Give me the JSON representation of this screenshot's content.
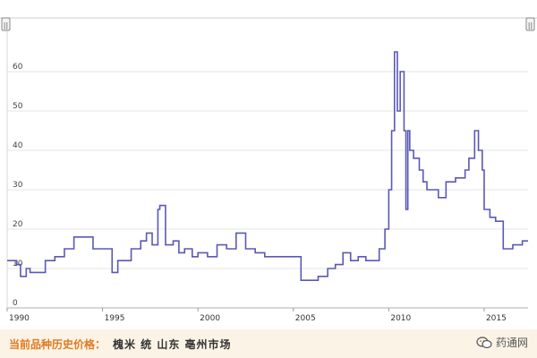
{
  "chart_data": {
    "type": "line",
    "title": "",
    "xlabel": "",
    "ylabel": "",
    "xlim": [
      1990,
      2017.3
    ],
    "ylim": [
      0,
      70
    ],
    "x_ticks": [
      "1990",
      "1995",
      "2000",
      "2005",
      "2010",
      "2015"
    ],
    "y_ticks": [
      "0",
      "10",
      "20",
      "30",
      "40",
      "50",
      "60"
    ],
    "grid": "horizontal",
    "line_color": "#5a58b8",
    "series": [
      {
        "name": "",
        "x": [
          1990.0,
          1990.5,
          1990.7,
          1991.0,
          1991.2,
          1991.5,
          1992.0,
          1992.5,
          1993.0,
          1993.5,
          1994.0,
          1994.5,
          1995.0,
          1995.2,
          1995.5,
          1995.8,
          1996.2,
          1996.5,
          1997.0,
          1997.3,
          1997.6,
          1997.9,
          1998.0,
          1998.3,
          1998.7,
          1999.0,
          1999.3,
          1999.7,
          2000.0,
          2000.5,
          2001.0,
          2001.5,
          2002.0,
          2002.5,
          2003.0,
          2003.5,
          2004.0,
          2004.5,
          2004.9,
          2005.1,
          2005.4,
          2005.8,
          2006.3,
          2006.8,
          2007.2,
          2007.6,
          2008.0,
          2008.4,
          2008.8,
          2009.2,
          2009.5,
          2009.8,
          2010.0,
          2010.15,
          2010.3,
          2010.45,
          2010.6,
          2010.8,
          2010.9,
          2011.0,
          2011.1,
          2011.3,
          2011.6,
          2011.8,
          2012.0,
          2012.3,
          2012.6,
          2013.0,
          2013.5,
          2014.0,
          2014.2,
          2014.5,
          2014.7,
          2014.9,
          2015.0,
          2015.3,
          2015.6,
          2016.0,
          2016.5,
          2017.0,
          2017.2
        ],
        "y": [
          12,
          11,
          8,
          10,
          9,
          9,
          12,
          13,
          15,
          18,
          18,
          15,
          15,
          15,
          9,
          12,
          12,
          15,
          17,
          19,
          16,
          25,
          26,
          16,
          17,
          14,
          15,
          13,
          14,
          13,
          16,
          15,
          19,
          15,
          14,
          13,
          13,
          13,
          13,
          13,
          7,
          7,
          8,
          10,
          11,
          14,
          12,
          13,
          12,
          12,
          15,
          20,
          30,
          45,
          65,
          50,
          60,
          45,
          25,
          45,
          40,
          38,
          35,
          32,
          30,
          30,
          28,
          32,
          33,
          35,
          38,
          45,
          40,
          35,
          25,
          23,
          22,
          15,
          16,
          17,
          17
        ]
      }
    ]
  },
  "range_handles": {
    "left": "||",
    "right": "||"
  },
  "footer": {
    "title": "当前品种历史价格：",
    "item": "槐米  统  山东  亳州市场"
  },
  "watermark": {
    "icon": "wechat-icon",
    "text": "药通网"
  }
}
